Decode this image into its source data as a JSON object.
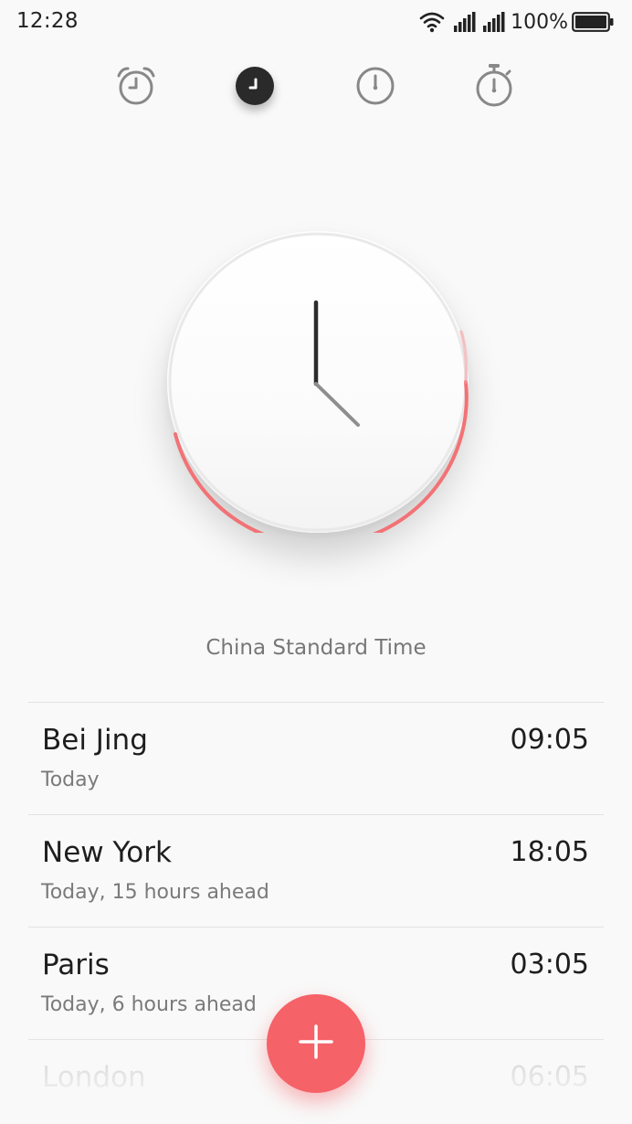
{
  "status_bar": {
    "time": "12:28",
    "battery": "100%",
    "icons": [
      "wifi-icon",
      "signal-icon",
      "signal-icon",
      "battery-icon"
    ]
  },
  "tabs": [
    {
      "name": "alarm",
      "icon": "alarm-clock-icon",
      "active": false
    },
    {
      "name": "world-clock",
      "icon": "clock-icon",
      "active": true
    },
    {
      "name": "timer",
      "icon": "timer-icon",
      "active": false
    },
    {
      "name": "stopwatch",
      "icon": "stopwatch-icon",
      "active": false
    }
  ],
  "clock": {
    "timezone": "China Standard Time",
    "accent_color": "#f26b6f"
  },
  "cities": [
    {
      "city": "Bei Jing",
      "sub": "Today",
      "time": "09:05"
    },
    {
      "city": "New York",
      "sub": "Today, 15 hours ahead",
      "time": "18:05"
    },
    {
      "city": "Paris",
      "sub": "Today, 6 hours ahead",
      "time": "03:05"
    },
    {
      "city": "London",
      "sub": "",
      "time": "06:05"
    }
  ],
  "fab": {
    "icon": "plus-icon",
    "color": "#f56268"
  }
}
